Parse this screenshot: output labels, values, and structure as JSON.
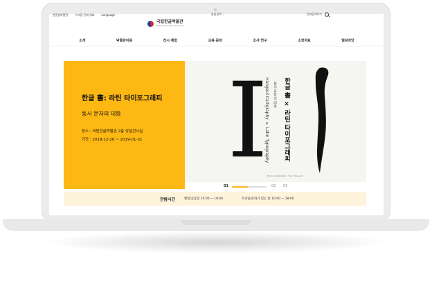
{
  "header": {
    "util_links": [
      "한글날박물관",
      "누리집 안내 개요",
      "Language ·"
    ],
    "right_util": {
      "site_search": "통합검색 ⌄",
      "keyword": "전체검색하기"
    },
    "logo": {
      "ko": "국립한글박물관",
      "en": "National Hangeul Museum"
    }
  },
  "nav": {
    "items": [
      "소개",
      "박물관이용",
      "전시·체험",
      "교육·문화",
      "조사·연구",
      "소장자료",
      "열린마당"
    ]
  },
  "hero": {
    "title": "한글 書: 라틴 타이포그래피",
    "subtitle": "동서 문자의 대화",
    "place": "장소 : 국립한글박물관 2층 상설전시실",
    "period": "기간 : 2018-12-26 ~ 2019-01-31",
    "poster": {
      "latin_letter": "I",
      "en_vertical": "Hangeul Calligraphy × Latin Typography",
      "en_sub": "동서 문자의 대화",
      "ko_vertical": "한글 書 × 라틴 타이포그래피",
      "credit": "Hanna Calligraphy · Seo Chae-won"
    },
    "color": "#fdb813"
  },
  "slider": {
    "current": "01",
    "pages": [
      "02",
      "03"
    ],
    "progress": 0.45
  },
  "hours": {
    "label": "관람시간",
    "weekday": "평일/공휴일 10:00 ~ 18:00",
    "saturday": "토요일/문화가 있는 날 10:00 ~ 18:00"
  }
}
